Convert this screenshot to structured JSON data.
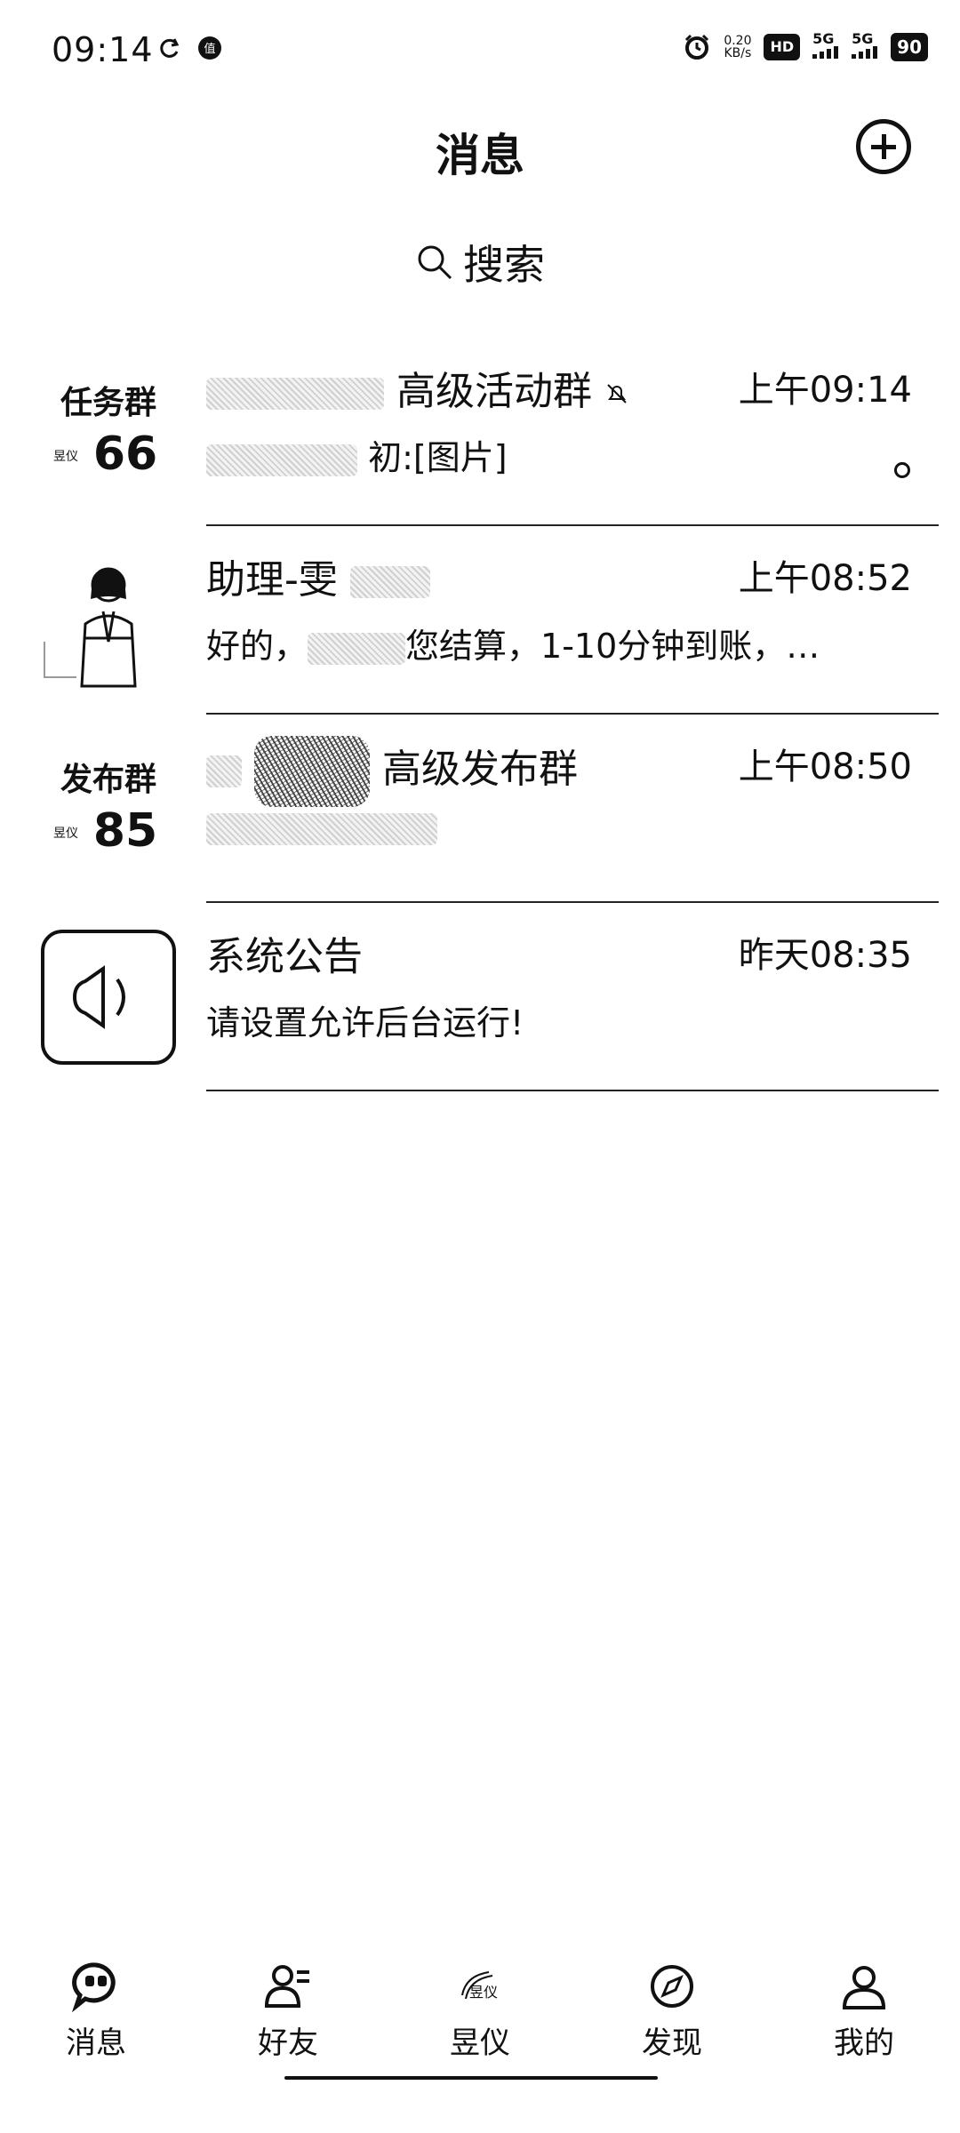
{
  "status_bar": {
    "time": "09:14",
    "net_speed_value": "0.20",
    "net_speed_unit": "KB/s",
    "hd_label": "HD",
    "signal1": "5G",
    "signal2": "5G",
    "battery": "90"
  },
  "header": {
    "title": "消息"
  },
  "search": {
    "label": "搜索"
  },
  "chats": [
    {
      "avatar_line1": "任务群",
      "avatar_line2": "66",
      "name": "高级活动群",
      "time": "上午09:14",
      "preview": "初:[图片]"
    },
    {
      "name": "助理-雯",
      "time": "上午08:52",
      "preview": "好的，",
      "preview_rest": "您结算，1-10分钟到账，…"
    },
    {
      "avatar_line1": "发布群",
      "avatar_line2": "85",
      "name": "高级发布群",
      "time": "上午08:50",
      "preview": ""
    },
    {
      "name": "系统公告",
      "time": "昨天08:35",
      "preview": "请设置允许后台运行!"
    }
  ],
  "avatar_badge": "昱仪",
  "bottom_nav": [
    {
      "label": "消息",
      "icon": "chat-bubble-icon"
    },
    {
      "label": "好友",
      "icon": "friends-icon"
    },
    {
      "label": "昱仪",
      "icon": "brand-logo-icon"
    },
    {
      "label": "发现",
      "icon": "compass-icon"
    },
    {
      "label": "我的",
      "icon": "profile-icon"
    }
  ]
}
